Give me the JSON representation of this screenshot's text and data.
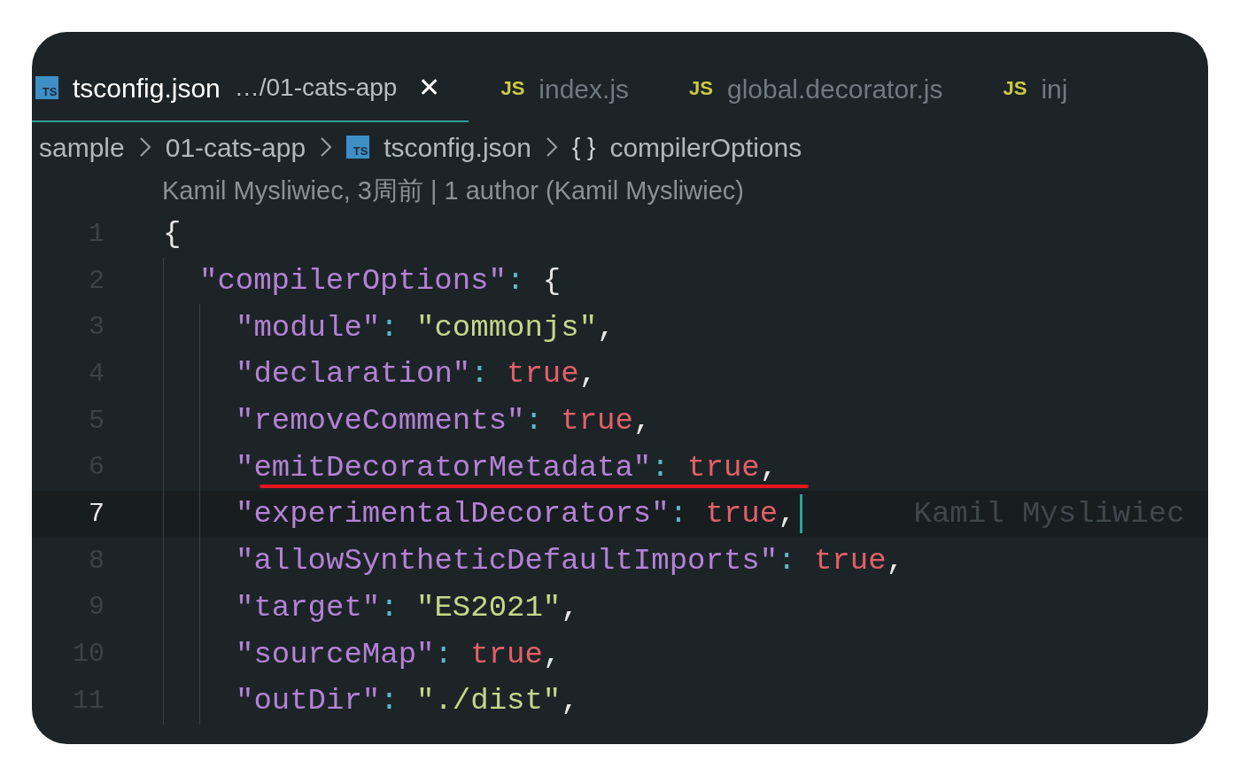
{
  "tabs": [
    {
      "kind": "ts",
      "icon_text": "TS",
      "label": "tsconfig.json",
      "description": "…/01-cats-app",
      "close": "✕",
      "selected": true
    },
    {
      "kind": "js",
      "icon_text": "JS",
      "label": "index.js",
      "selected": false
    },
    {
      "kind": "js",
      "icon_text": "JS",
      "label": "global.decorator.js",
      "selected": false
    },
    {
      "kind": "js",
      "icon_text": "JS",
      "label": "inj",
      "selected": false
    }
  ],
  "breadcrumb": [
    {
      "kind": "folder",
      "label": "sample"
    },
    {
      "kind": "folder",
      "label": "01-cats-app"
    },
    {
      "kind": "file",
      "icon_text": "TS",
      "label": "tsconfig.json"
    },
    {
      "kind": "object",
      "icon_text": "{ }",
      "label": "compilerOptions"
    }
  ],
  "codelens": "Kamil Mysliwiec, 3周前 | 1 author (Kamil Mysliwiec)",
  "lines": [
    {
      "number": "1",
      "selected": false,
      "tokens": [
        {
          "kind": "brace",
          "text": "{"
        }
      ],
      "children": [
        {
          "number": "2",
          "selected": false,
          "tokens": [
            {
              "kind": "key",
              "text": "\"compilerOptions\""
            },
            {
              "kind": "punct",
              "text": ": "
            },
            {
              "kind": "brace",
              "text": "{"
            }
          ],
          "children": [
            {
              "number": "3",
              "selected": false,
              "tokens": [
                {
                  "kind": "key",
                  "text": "\"module\""
                },
                {
                  "kind": "punct",
                  "text": ": "
                },
                {
                  "kind": "string",
                  "text": "\"commonjs\""
                },
                {
                  "kind": "comma",
                  "text": ","
                }
              ]
            },
            {
              "number": "4",
              "selected": false,
              "tokens": [
                {
                  "kind": "key",
                  "text": "\"declaration\""
                },
                {
                  "kind": "punct",
                  "text": ": "
                },
                {
                  "kind": "bool",
                  "text": "true"
                },
                {
                  "kind": "comma",
                  "text": ","
                }
              ]
            },
            {
              "number": "5",
              "selected": false,
              "tokens": [
                {
                  "kind": "key",
                  "text": "\"removeComments\""
                },
                {
                  "kind": "punct",
                  "text": ": "
                },
                {
                  "kind": "bool",
                  "text": "true"
                },
                {
                  "kind": "comma",
                  "text": ","
                }
              ]
            },
            {
              "number": "6",
              "selected": false,
              "underlined": true,
              "tokens": [
                {
                  "kind": "key",
                  "text": "\"emitDecoratorMetadata\""
                },
                {
                  "kind": "punct",
                  "text": ": "
                },
                {
                  "kind": "bool",
                  "text": "true"
                },
                {
                  "kind": "comma",
                  "text": ","
                }
              ]
            },
            {
              "number": "7",
              "selected": true,
              "blame": "Kamil Mysliwiec",
              "tokens": [
                {
                  "kind": "key",
                  "text": "\"experimentalDecorators\""
                },
                {
                  "kind": "punct",
                  "text": ": "
                },
                {
                  "kind": "bool",
                  "text": "true"
                },
                {
                  "kind": "comma",
                  "text": ","
                }
              ]
            },
            {
              "number": "8",
              "selected": false,
              "tokens": [
                {
                  "kind": "key",
                  "text": "\"allowSyntheticDefaultImports\""
                },
                {
                  "kind": "punct",
                  "text": ": "
                },
                {
                  "kind": "bool",
                  "text": "true"
                },
                {
                  "kind": "comma",
                  "text": ","
                }
              ]
            },
            {
              "number": "9",
              "selected": false,
              "tokens": [
                {
                  "kind": "key",
                  "text": "\"target\""
                },
                {
                  "kind": "punct",
                  "text": ": "
                },
                {
                  "kind": "string",
                  "text": "\"ES2021\""
                },
                {
                  "kind": "comma",
                  "text": ","
                }
              ]
            },
            {
              "number": "10",
              "selected": false,
              "tokens": [
                {
                  "kind": "key",
                  "text": "\"sourceMap\""
                },
                {
                  "kind": "punct",
                  "text": ": "
                },
                {
                  "kind": "bool",
                  "text": "true"
                },
                {
                  "kind": "comma",
                  "text": ","
                }
              ]
            },
            {
              "number": "11",
              "selected": false,
              "tokens": [
                {
                  "kind": "key",
                  "text": "\"outDir\""
                },
                {
                  "kind": "punct",
                  "text": ": "
                },
                {
                  "kind": "string",
                  "text": "\"./dist\""
                },
                {
                  "kind": "comma",
                  "text": ","
                }
              ]
            }
          ]
        }
      ]
    }
  ]
}
